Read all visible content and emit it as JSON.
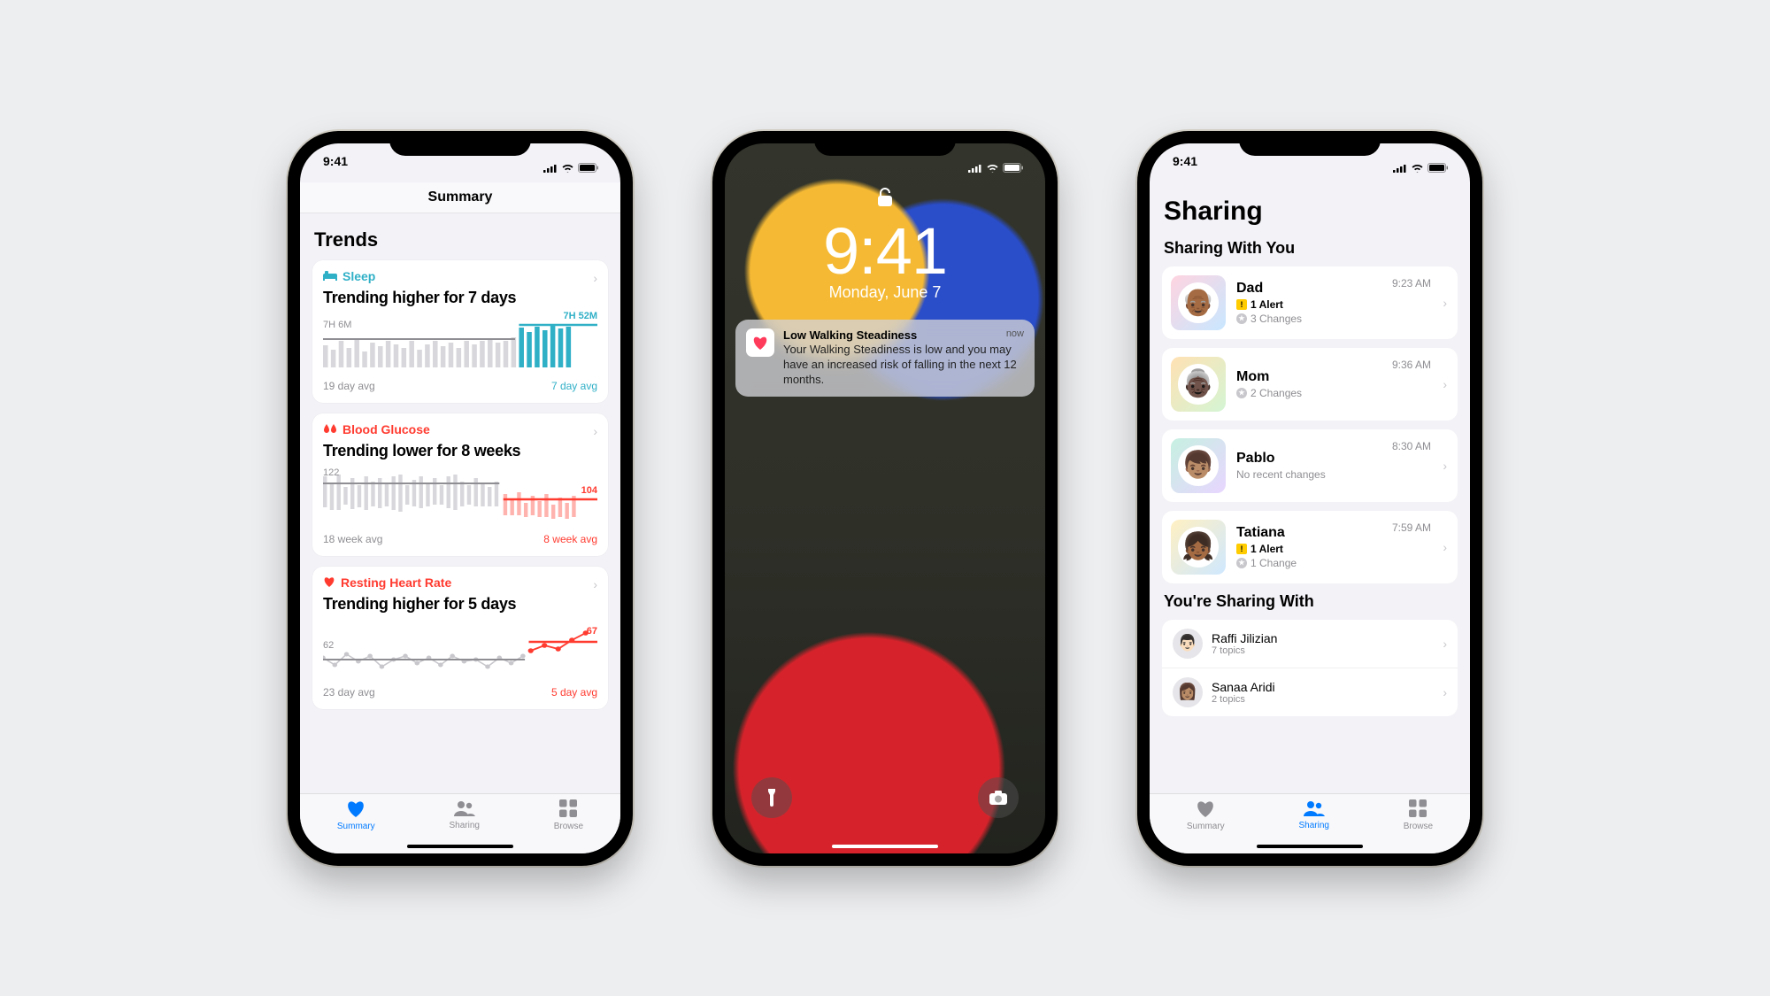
{
  "status": {
    "time": "9:41"
  },
  "phone1": {
    "header": "Summary",
    "section": "Trends",
    "cards": [
      {
        "icon": "sleep-icon",
        "label": "Sleep",
        "color": "teal",
        "title": "Trending higher for 7 days",
        "leftVal": "7H 6M",
        "rightVal": "7H 52M",
        "leftAvg": "19 day avg",
        "rightAvg": "7 day avg"
      },
      {
        "icon": "blood-glucose-icon",
        "label": "Blood Glucose",
        "color": "red",
        "title": "Trending lower for 8 weeks",
        "leftVal": "122",
        "rightVal": "104",
        "leftAvg": "18 week avg",
        "rightAvg": "8 week avg"
      },
      {
        "icon": "heart-icon",
        "label": "Resting Heart Rate",
        "color": "red",
        "title": "Trending higher for 5 days",
        "leftVal": "62",
        "rightVal": "67",
        "leftAvg": "23 day avg",
        "rightAvg": "5 day avg"
      }
    ],
    "tabs": {
      "summary": "Summary",
      "sharing": "Sharing",
      "browse": "Browse"
    }
  },
  "phone2": {
    "time": "9:41",
    "date": "Monday, June 7",
    "notif": {
      "title": "Low Walking Steadiness",
      "body": "Your Walking Steadiness is low and you may have an increased risk of falling in the next 12 months.",
      "when": "now"
    }
  },
  "phone3": {
    "title": "Sharing",
    "sectionA": "Sharing With You",
    "sectionB": "You're Sharing With",
    "people": [
      {
        "name": "Dad",
        "time": "9:23 AM",
        "alerts": "1 Alert",
        "changes": "3 Changes",
        "bg": "linear-gradient(135deg,#ffd4e0,#c8e7ff)",
        "emoji": "👴🏾"
      },
      {
        "name": "Mom",
        "time": "9:36 AM",
        "alerts": "",
        "changes": "2 Changes",
        "bg": "linear-gradient(135deg,#ffe1b3,#d4f5d4)",
        "emoji": "👵🏿"
      },
      {
        "name": "Pablo",
        "time": "8:30 AM",
        "alerts": "",
        "changes": "",
        "sub": "No recent changes",
        "bg": "linear-gradient(135deg,#c6f0e1,#e8d6ff)",
        "emoji": "👦🏽"
      },
      {
        "name": "Tatiana",
        "time": "7:59 AM",
        "alerts": "1 Alert",
        "changes": "1 Change",
        "bg": "linear-gradient(135deg,#fff0c2,#cfe8ff)",
        "emoji": "👧🏾"
      }
    ],
    "outgoing": [
      {
        "name": "Raffi Jilizian",
        "sub": "7 topics",
        "emoji": "👨🏻"
      },
      {
        "name": "Sanaa Aridi",
        "sub": "2 topics",
        "emoji": "👩🏽"
      }
    ],
    "tabs": {
      "summary": "Summary",
      "sharing": "Sharing",
      "browse": "Browse"
    }
  }
}
